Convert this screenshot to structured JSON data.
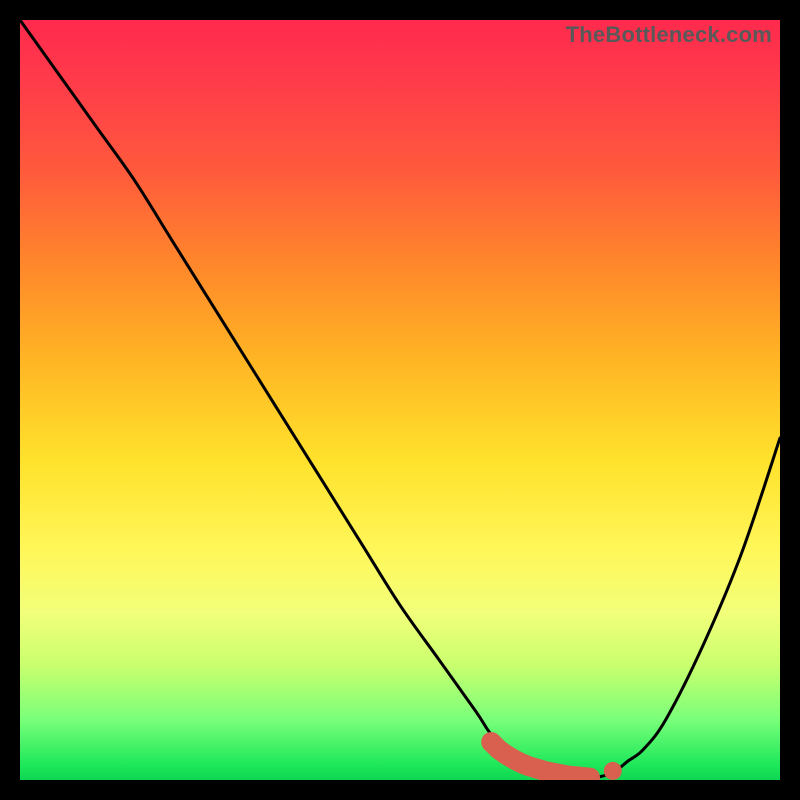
{
  "watermark": "TheBottleneck.com",
  "colors": {
    "frame": "#000000",
    "curve": "#000000",
    "marker": "#d9604f",
    "marker_stroke": "#d9604f"
  },
  "chart_data": {
    "type": "line",
    "title": "",
    "xlabel": "",
    "ylabel": "",
    "xlim": [
      0,
      100
    ],
    "ylim": [
      0,
      100
    ],
    "grid": false,
    "legend": false,
    "series": [
      {
        "name": "bottleneck-curve",
        "x": [
          0,
          5,
          10,
          15,
          20,
          25,
          30,
          35,
          40,
          45,
          50,
          55,
          60,
          62,
          65,
          68,
          70,
          75,
          78,
          80,
          82,
          85,
          90,
          95,
          100
        ],
        "y": [
          100,
          93,
          86,
          79,
          71,
          63,
          55,
          47,
          39,
          31,
          23,
          16,
          9,
          6,
          3,
          1.5,
          1,
          0.3,
          1,
          2.5,
          4,
          8,
          18,
          30,
          45
        ]
      }
    ],
    "markers": {
      "name": "optimal-range",
      "x": [
        62,
        63,
        64,
        65,
        66,
        67,
        68,
        69,
        70,
        71,
        72,
        73,
        74,
        75,
        76,
        77,
        78
      ],
      "y": [
        5,
        4,
        3.3,
        2.7,
        2.2,
        1.8,
        1.5,
        1.2,
        1,
        0.8,
        0.6,
        0.5,
        0.4,
        0.3,
        0.5,
        0.8,
        1.2
      ]
    }
  }
}
